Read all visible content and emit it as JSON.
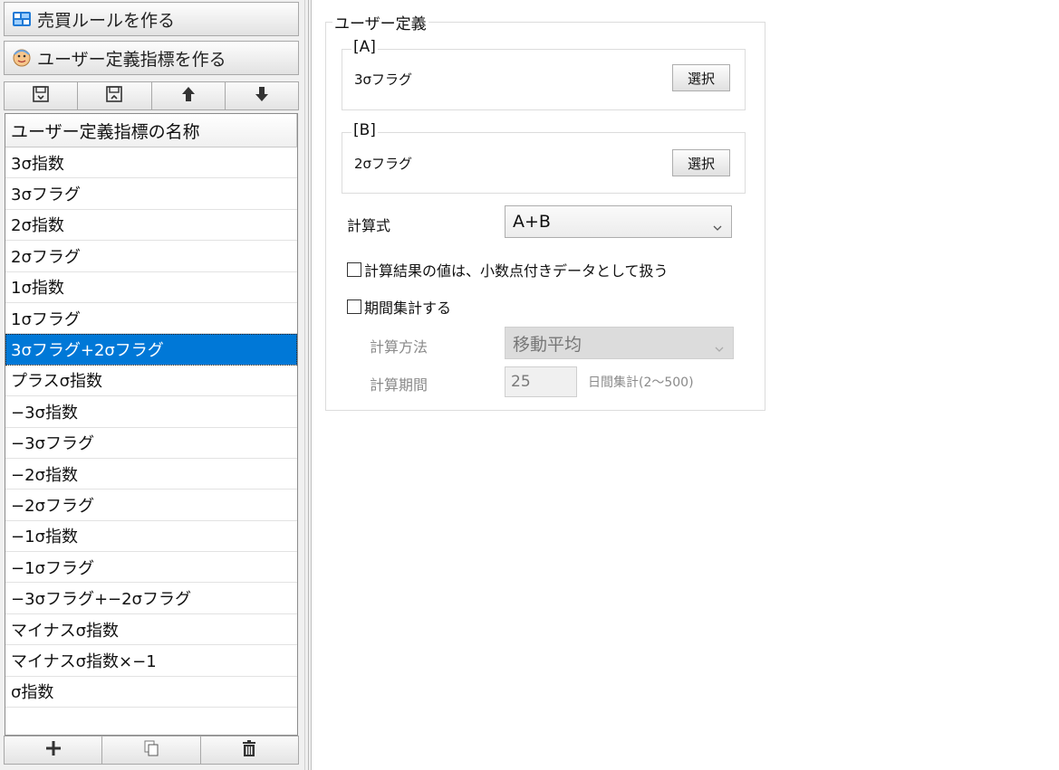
{
  "nav": {
    "rules_button": "売買ルールを作る",
    "indicator_button": "ユーザー定義指標を作る"
  },
  "list": {
    "header": "ユーザー定義指標の名称",
    "items": [
      "3σ指数",
      "3σフラグ",
      "2σ指数",
      "2σフラグ",
      "1σ指数",
      "1σフラグ",
      "3σフラグ+2σフラグ",
      "プラスσ指数",
      "−3σ指数",
      "−3σフラグ",
      "−2σ指数",
      "−2σフラグ",
      "−1σ指数",
      "−1σフラグ",
      "−3σフラグ+−2σフラグ",
      "マイナスσ指数",
      "マイナスσ指数×−1",
      "σ指数"
    ],
    "selected_index": 6
  },
  "user_def": {
    "legend": "ユーザー定義",
    "a": {
      "legend": "[A]",
      "value": "3σフラグ",
      "button": "選択"
    },
    "b": {
      "legend": "[B]",
      "value": "2σフラグ",
      "button": "選択"
    },
    "formula_label": "計算式",
    "formula_value": "A+B",
    "decimal_checkbox_label": "計算結果の値は、小数点付きデータとして扱う",
    "decimal_checked": false,
    "period_checkbox_label": "期間集計する",
    "period_checked": false,
    "calc_method_label": "計算方法",
    "calc_method_value": "移動平均",
    "calc_period_label": "計算期間",
    "calc_period_value": "25",
    "calc_period_unit": "日間集計(2〜500)"
  },
  "colors": {
    "selection": "#0078d7"
  }
}
